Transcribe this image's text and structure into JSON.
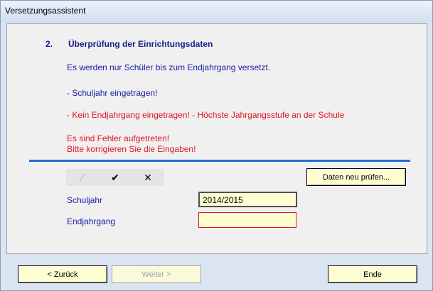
{
  "window": {
    "title": "Versetzungsassistent"
  },
  "step": {
    "number": "2.",
    "title": "Überprüfung  der Einrichtungsdaten",
    "info": "Es werden nur Schüler bis zum Endjahrgang versetzt.",
    "ok_messages": [
      "- Schuljahr eingetragen!"
    ],
    "error_messages": [
      "- Kein Endjahrgang eingetragen! - Höchste Jahrgangsstufe an der Schule",
      "Es sind Fehler aufgetreten!",
      "Bitte korrigieren Sie die Eingaben!"
    ]
  },
  "toolbar": {
    "edit_glyph": "⁄",
    "confirm_glyph": "✔",
    "cancel_glyph": "✕"
  },
  "actions": {
    "recheck_label": "Daten neu prüfen..."
  },
  "form": {
    "schuljahr_label": "Schuljahr",
    "schuljahr_value": "2014/2015",
    "endjahrgang_label": "Endjahrgang",
    "endjahrgang_value": ""
  },
  "footer": {
    "back_label": "< Zurück",
    "next_label": "Weiter >",
    "end_label": "Ende"
  },
  "colors": {
    "accent": "#1e6fd6",
    "error": "#e0141e",
    "text_blue": "#1a1aa6",
    "field_bg": "#fefed2"
  }
}
